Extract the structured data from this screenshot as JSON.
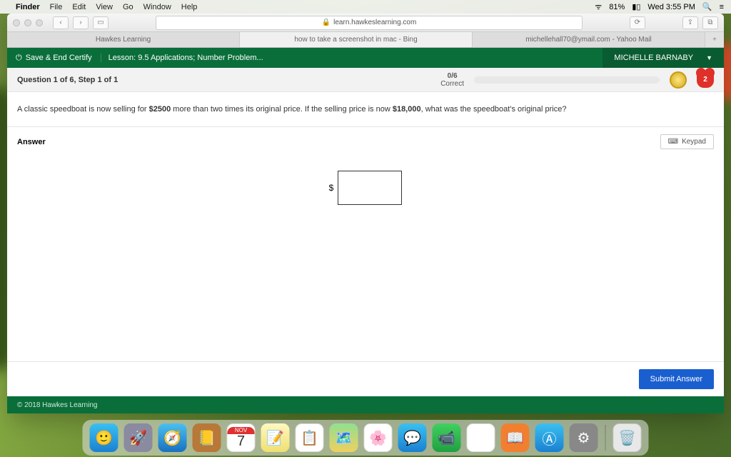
{
  "menubar": {
    "app": "Finder",
    "items": [
      "File",
      "Edit",
      "View",
      "Go",
      "Window",
      "Help"
    ],
    "battery": "81%",
    "clock": "Wed 3:55 PM"
  },
  "safari": {
    "url": "learn.hawkeslearning.com",
    "tabs": [
      "Hawkes Learning",
      "how to take a screenshot in mac - Bing",
      "michellehall70@ymail.com - Yahoo Mail"
    ]
  },
  "app": {
    "save_label": "Save & End Certify",
    "lesson": "Lesson: 9.5 Applications; Number Problem...",
    "user": "MICHELLE BARNABY",
    "question_header": "Question 1 of 6, Step 1 of 1",
    "score_num": "0/6",
    "score_label": "Correct",
    "heart": "2",
    "question": {
      "p1": "A classic speedboat is now selling for ",
      "b1": "$2500",
      "p2": " more than two times its original price.  If the selling price is now ",
      "b2": "$18,000",
      "p3": ", what was the speedboat's original price?"
    },
    "answer_label": "Answer",
    "keypad_label": "Keypad",
    "currency": "$",
    "submit": "Submit Answer",
    "footer": "© 2018 Hawkes Learning"
  },
  "dock": {
    "cal_month": "NOV",
    "cal_day": "7"
  }
}
